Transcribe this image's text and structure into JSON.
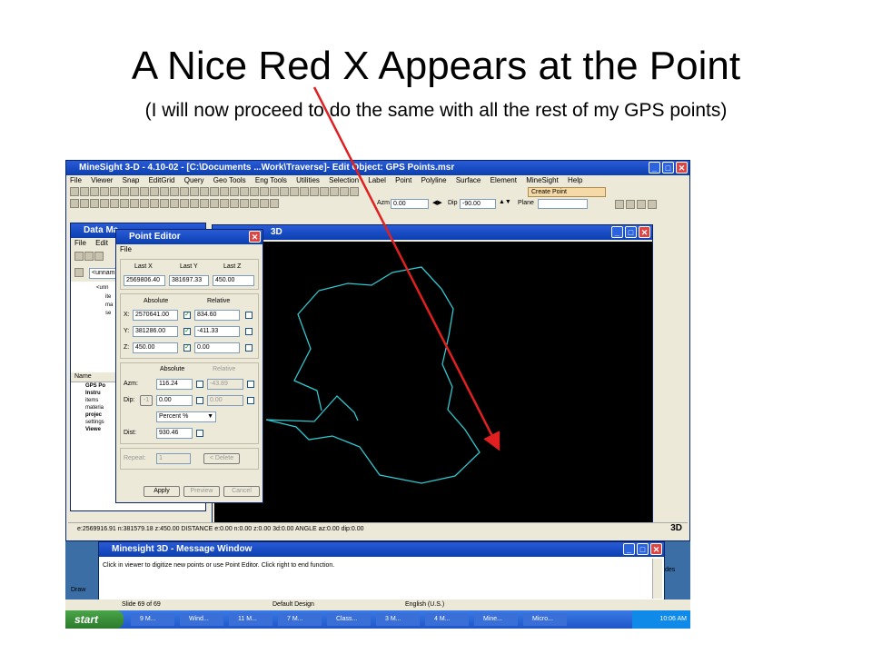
{
  "slide": {
    "title": "A Nice Red X Appears at the Point",
    "subtitle": "(I will now proceed to do the same with all the rest of my GPS points)"
  },
  "main_window": {
    "title": "MineSight 3-D  - 4.10-02 - [C:\\Documents ...Work\\Traverse]- Edit Object: GPS Points.msr",
    "menu": [
      "File",
      "Viewer",
      "Snap",
      "EditGrid",
      "Query",
      "Geo Tools",
      "Eng Tools",
      "Utilities",
      "Selection",
      "Label",
      "Point",
      "Polyline",
      "Surface",
      "Element",
      "MineSight",
      "Help"
    ],
    "operation_label": "Create Point",
    "azm_label": "Azm",
    "azm_value": "0.00",
    "dip_label": "Dip",
    "dip_value": "-90.00",
    "plane_label": "Plane",
    "status_bar": "e:2569916.91   n:381579.18   z:450.00   DISTANCE   e:0.00   n:0.00   z:0.00   3d:0.00    ANGLE   az:0.00   dip:0.00",
    "status_badge": "3D"
  },
  "data_manager": {
    "title": "Data Ma",
    "menu": [
      "File",
      "Edit",
      "V"
    ],
    "path_value": "<unnam",
    "tree_items": [
      "<unn",
      "ite",
      "ma",
      "se"
    ],
    "list_header": "Name",
    "list_items": [
      "GPS Po",
      "Instru",
      "items",
      "materia",
      "projec",
      "settings",
      "Viewe"
    ]
  },
  "viewer": {
    "title": "3D",
    "traverse_color": "#30c8d0",
    "background": "#000000"
  },
  "point_editor": {
    "title": "Point Editor",
    "menu_file": "File",
    "last_x_label": "Last X",
    "last_y_label": "Last Y",
    "last_z_label": "Last Z",
    "last_x": "2569806.40",
    "last_y": "381697.33",
    "last_z": "450.00",
    "absolute_label": "Absolute",
    "relative_label": "Relative",
    "x_label": "X:",
    "y_label": "Y:",
    "z_label": "Z:",
    "x_abs": "2570641.00",
    "y_abs": "381286.00",
    "z_abs": "450.00",
    "x_rel": "834.60",
    "y_rel": "-411.33",
    "z_rel": "0.00",
    "azm_label": "Azm:",
    "dip_label": "Dip:",
    "dist_label": "Dist:",
    "azm_abs": "116.24",
    "azm_rel": "-43.89",
    "dip_minus": "-1",
    "dip_abs": "0.00",
    "dip_rel": "0.00",
    "percent_value": "Percent %",
    "dist_value": "930.46",
    "repeat_label": "Repeat:",
    "repeat_value": "1",
    "delete_label": "< Delete",
    "apply_label": "Apply",
    "preview_label": "Preview",
    "cancel_label": "Cancel"
  },
  "message_window": {
    "title": "Minesight 3D - Message Window",
    "message": "Click in viewer to digitize new points or use Point Editor.  Click right to end function."
  },
  "ppt_status": {
    "slide": "Slide 69 of 69",
    "design": "Default Design",
    "language": "English (U.S.)",
    "draw": "Draw",
    "des": "des"
  },
  "taskbar": {
    "start": "start",
    "items": [
      "9 M...",
      "Wind...",
      "11 M...",
      "7 M...",
      "Class...",
      "3 M...",
      "4 M...",
      "Mine...",
      "Micro..."
    ],
    "clock": "10:06 AM"
  },
  "annotation": {
    "arrow_color": "#e02020"
  }
}
